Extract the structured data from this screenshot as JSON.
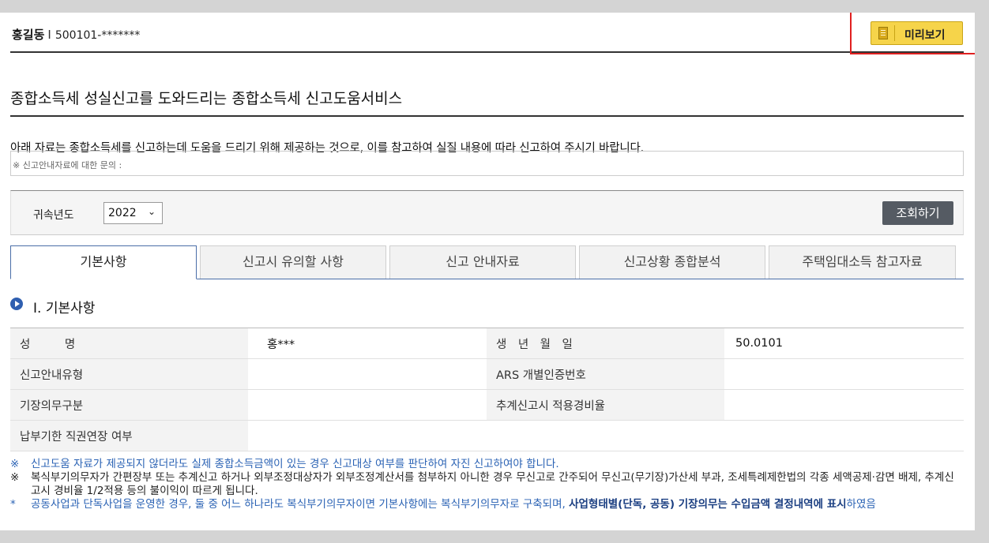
{
  "user": {
    "name": "홍길동",
    "separator": "I",
    "id": "500101-*******"
  },
  "preview_button": {
    "label": "미리보기",
    "icon": "document-icon"
  },
  "main_title": "종합소득세 성실신고를 도와드리는 종합소득세 신고도움서비스",
  "intro_text": "아래 자료는 종합소득세를 신고하는데 도움을 드리기 위해 제공하는 것으로, 이를 참고하여 실질 내용에 따라 신고하여 주시기 바랍니다.",
  "inquiry_text": "※ 신고안내자료에 대한 문의 : ",
  "search": {
    "year_label": "귀속년도",
    "year_value": "2022",
    "button_label": "조회하기"
  },
  "tabs": [
    {
      "label": "기본사항",
      "active": true
    },
    {
      "label": "신고시 유의할 사항",
      "active": false
    },
    {
      "label": "신고 안내자료",
      "active": false
    },
    {
      "label": "신고상황 종합분석",
      "active": false
    },
    {
      "label": "주택임대소득 참고자료",
      "active": false
    }
  ],
  "section_title": "Ⅰ. 기본사항",
  "info_rows": [
    {
      "h1": "성　　　명",
      "v1": "홍***",
      "h2": "생　년　월　일",
      "v2": "50.0101"
    },
    {
      "h1": "신고안내유형",
      "v1": "",
      "h2": "ARS 개별인증번호",
      "v2": ""
    },
    {
      "h1": "기장의무구분",
      "v1": "",
      "h2": "추계신고시 적용경비율",
      "v2": ""
    },
    {
      "h1": "납부기한 직권연장 여부",
      "v1": ""
    }
  ],
  "notes": {
    "n1_mark": "※",
    "n1": "신고도움 자료가 제공되지 않더라도 실제 종합소득금액이 있는 경우 신고대상 여부를 판단하여 자진 신고하여야 합니다.",
    "n2_mark": "※",
    "n2": "복식부기의무자가 간편장부 또는 추계신고 하거나 외부조정대상자가 외부조정계산서를 첨부하지 아니한 경우 무신고로 간주되어 무신고(무기장)가산세 부과, 조세특례제한법의 각종 세액공제·감면 배제, 추계신고시 경비율 1/2적용 등의 불이익이 따르게 됩니다.",
    "n3_mark": "*",
    "n3_a": "공동사업과 단독사업을 운영한 경우, 둘 중 어느 하나라도 복식부기의무자이면 기본사항에는 복식부기의무자로 구축되며, ",
    "n3_b": "사업형태별(단독, 공동) 기장의무는 수입금액 결정내역에 표시",
    "n3_c": "하였음"
  },
  "colors": {
    "accent": "#2f5fb0",
    "button_yellow": "#f6d44a",
    "highlight_red": "#e02020",
    "search_button": "#555b63"
  }
}
